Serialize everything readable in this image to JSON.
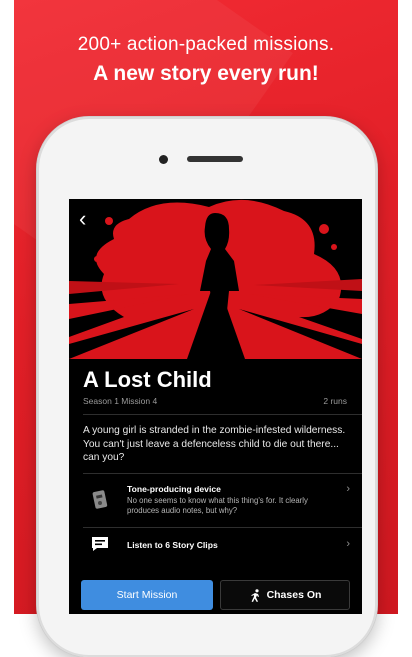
{
  "promo": {
    "headline_line1": "200+ action-packed missions.",
    "headline_line2": "A new story every run!",
    "background_color": "#e11f27"
  },
  "nav": {
    "back_icon": "chevron-left-icon"
  },
  "mission": {
    "title": "A Lost Child",
    "season_mission": "Season 1 Mission 4",
    "runs": "2 runs",
    "description": "A young girl is stranded in the zombie-infested wilderness. You can't just leave a defenceless child to die out there... can you?"
  },
  "items": [
    {
      "icon": "device-icon",
      "title": "Tone-producing device",
      "subtitle": "No one seems to know what this thing's for. It clearly produces audio notes, but why?"
    },
    {
      "icon": "story-clips-icon",
      "title": "Listen to 6 Story Clips"
    }
  ],
  "buttons": {
    "start": "Start Mission",
    "chases": "Chases On",
    "chases_icon": "runner-icon",
    "accent": "#3f8de0"
  }
}
